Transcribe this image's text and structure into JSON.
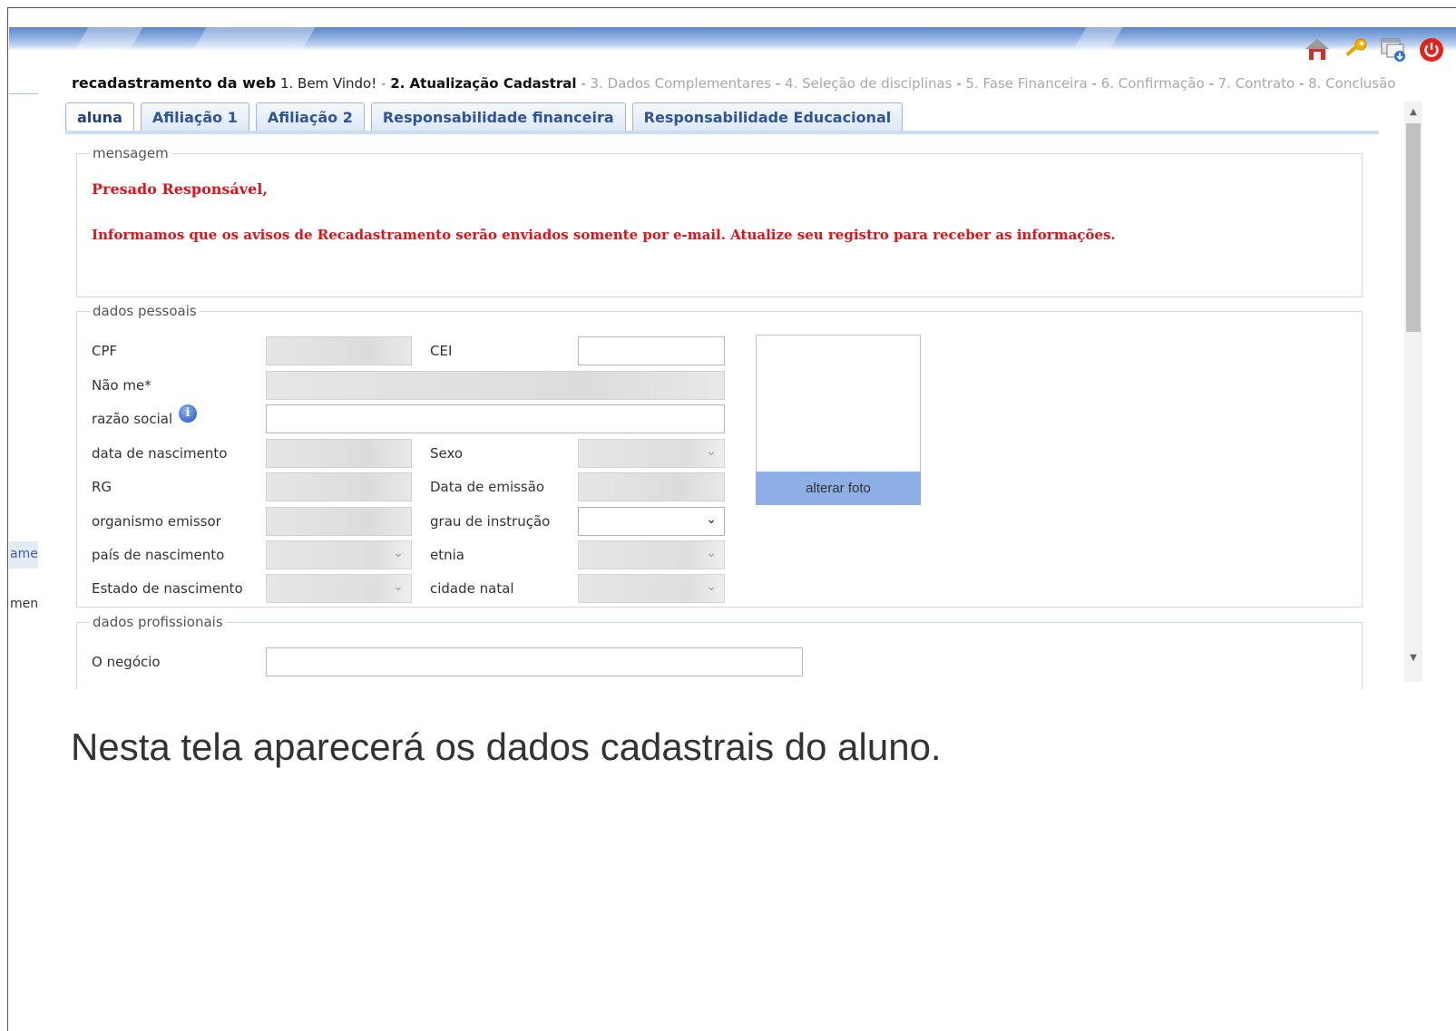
{
  "wizard": {
    "brand": "recadastramento da web",
    "steps": {
      "s1": "1. Bem Vindo!",
      "s2": "2. Atualização Cadastral",
      "s3": "3. Dados Complementares",
      "s4": "4. Seleção de disciplinas",
      "s5": "5. Fase Financeira",
      "s6": "6. Confirmação",
      "s7": "7. Contrato",
      "s8": "8. Conclusão"
    },
    "separator": " - "
  },
  "left_nav": {
    "fragment_a": "ame",
    "fragment_b": "men"
  },
  "tabs": [
    {
      "label": "aluna"
    },
    {
      "label": "Afiliação 1"
    },
    {
      "label": "Afiliação 2"
    },
    {
      "label": "Responsabilidade financeira"
    },
    {
      "label": "Responsabilidade Educacional"
    }
  ],
  "message": {
    "legend": "mensagem",
    "title": "Presado Responsável,",
    "body": "Informamos que os avisos de Recadastramento serão enviados somente por e-mail. Atualize seu registro para receber as informações."
  },
  "personal": {
    "legend": "dados pessoais",
    "labels": {
      "cpf": "CPF",
      "cei": "CEI",
      "nome": "Não me*",
      "razao": "razão social",
      "nascimento": "data de nascimento",
      "sexo": "Sexo",
      "rg": "RG",
      "emissao": "Data de emissão",
      "organismo": "organismo emissor",
      "grau": "grau de instrução",
      "pais": "país de nascimento",
      "etnia": "etnia",
      "estado": "Estado de nascimento",
      "cidade": "cidade natal"
    },
    "info_icon_glyph": "i",
    "photo_button": "alterar foto"
  },
  "professional": {
    "legend": "dados profissionais",
    "labels": {
      "negocio": "O negócio"
    }
  },
  "caption": "Nesta tela aparecerá os dados cadastrais do aluno.",
  "icons": [
    "home-icon",
    "key-icon",
    "window-download-icon",
    "power-icon"
  ],
  "colors": {
    "message_red": "#e0131a",
    "tab_blue": "#2f5596",
    "photo_button": "#8eaee6"
  }
}
